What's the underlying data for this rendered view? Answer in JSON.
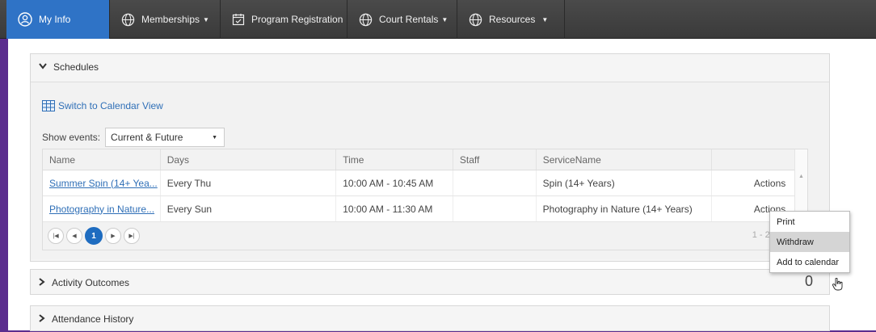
{
  "nav": {
    "items": [
      {
        "label": "My Info",
        "icon": "user-circle-icon",
        "active": true
      },
      {
        "label": "Memberships",
        "icon": "globe-icon",
        "caret": "▼"
      },
      {
        "label": "Program Registration",
        "icon": "calendar-check-icon"
      },
      {
        "label": "Court Rentals",
        "icon": "globe-icon",
        "caret": "▼"
      },
      {
        "label": "Resources",
        "icon": "globe-icon",
        "caret": "▼"
      }
    ],
    "colors": {
      "bar": "#3f3f3f",
      "active": "#2f73c6",
      "frame": "#5b2d8e"
    }
  },
  "schedules": {
    "title": "Schedules",
    "switch_label": "Switch to Calendar View",
    "show_events_label": "Show events:",
    "show_events_value": "Current & Future",
    "columns": [
      "Name",
      "Days",
      "Time",
      "Staff",
      "ServiceName",
      ""
    ],
    "rows": [
      {
        "name": "Summer Spin (14+ Yea...",
        "days": "Every Thu",
        "time": "10:00 AM - 10:45 AM",
        "staff": "",
        "service": "Spin (14+ Years)",
        "action": "Actions"
      },
      {
        "name": "Photography in Nature...",
        "days": "Every Sun",
        "time": "10:00 AM - 11:30 AM",
        "staff": "",
        "service": "Photography in Nature (14+ Years)",
        "action": "Actions"
      }
    ],
    "pager": {
      "current": "1",
      "info": "1 - 2 of"
    }
  },
  "context_menu": {
    "items": [
      "Print",
      "Withdraw",
      "Add to calendar"
    ],
    "hovered": "Withdraw"
  },
  "activity_outcomes": {
    "title": "Activity Outcomes",
    "count": "0"
  },
  "attendance_history": {
    "title": "Attendance History"
  }
}
